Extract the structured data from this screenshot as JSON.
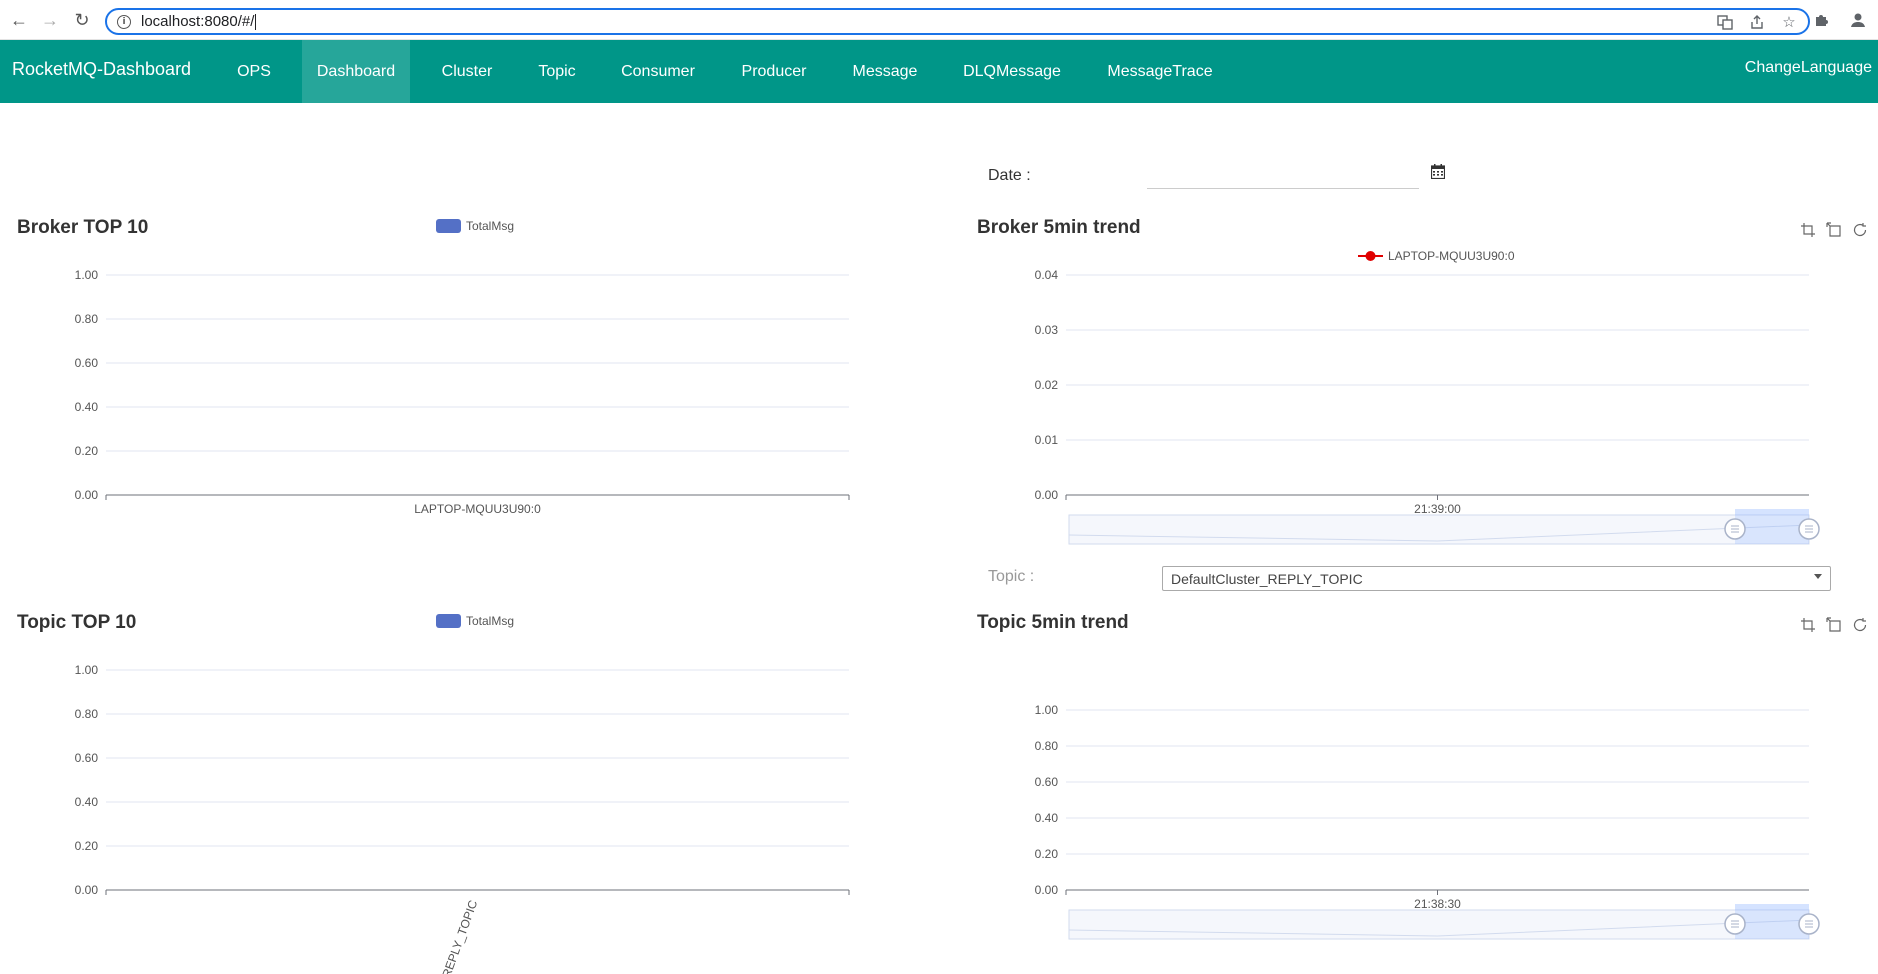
{
  "browser": {
    "url": "localhost:8080/#/"
  },
  "navbar": {
    "brand": "RocketMQ-Dashboard",
    "items": [
      {
        "label": "OPS"
      },
      {
        "label": "Dashboard"
      },
      {
        "label": "Cluster"
      },
      {
        "label": "Topic"
      },
      {
        "label": "Consumer"
      },
      {
        "label": "Producer"
      },
      {
        "label": "Message"
      },
      {
        "label": "DLQMessage"
      },
      {
        "label": "MessageTrace"
      }
    ],
    "active": "Dashboard",
    "change_language": "ChangeLanguage"
  },
  "date_filter": {
    "label": "Date :",
    "value": ""
  },
  "topic_filter": {
    "label": "Topic :",
    "selected": "DefaultCluster_REPLY_TOPIC"
  },
  "colors": {
    "primary": "#009688",
    "active_nav": "#26a69a",
    "bar_series": "#5470c6",
    "line_series": "#e00000"
  },
  "chart_data": [
    {
      "id": "broker-top10",
      "type": "bar",
      "title": "Broker TOP 10",
      "legend": [
        "TotalMsg"
      ],
      "categories": [
        "LAPTOP-MQUU3U90:0"
      ],
      "series": [
        {
          "name": "TotalMsg",
          "values": [
            0
          ]
        }
      ],
      "yticks": [
        "0.00",
        "0.20",
        "0.40",
        "0.60",
        "0.80",
        "1.00"
      ],
      "ylim": [
        0,
        1
      ]
    },
    {
      "id": "broker-5min-trend",
      "type": "line",
      "title": "Broker 5min trend",
      "legend": [
        "LAPTOP-MQUU3U90:0"
      ],
      "x": [
        "21:39:00"
      ],
      "series": [
        {
          "name": "LAPTOP-MQUU3U90:0",
          "values": []
        }
      ],
      "yticks": [
        "0.00",
        "0.01",
        "0.02",
        "0.03",
        "0.04"
      ],
      "ylim": [
        0,
        0.04
      ],
      "datazoom": true
    },
    {
      "id": "topic-top10",
      "type": "bar",
      "title": "Topic TOP 10",
      "legend": [
        "TotalMsg"
      ],
      "categories": [
        "REPLY_TOPIC"
      ],
      "series": [
        {
          "name": "TotalMsg",
          "values": [
            0
          ]
        }
      ],
      "yticks": [
        "0.00",
        "0.20",
        "0.40",
        "0.60",
        "0.80",
        "1.00"
      ],
      "ylim": [
        0,
        1
      ]
    },
    {
      "id": "topic-5min-trend",
      "type": "line",
      "title": "Topic 5min trend",
      "legend": [],
      "x": [
        "21:38:30"
      ],
      "series": [],
      "yticks": [
        "0.00",
        "0.20",
        "0.40",
        "0.60",
        "0.80",
        "1.00"
      ],
      "ylim": [
        0,
        1
      ],
      "datazoom": true
    }
  ]
}
